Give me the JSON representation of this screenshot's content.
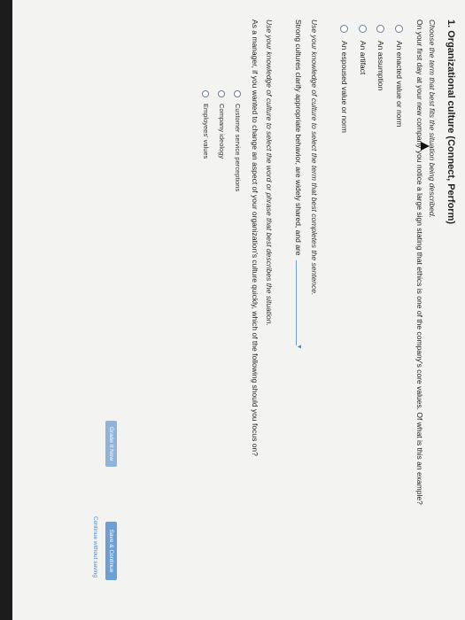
{
  "question": {
    "number_title": "1. Organizational culture (Connect, Perform)"
  },
  "part1": {
    "instruction": "Choose the term that best fits the situation being described.",
    "prompt": "On your first day at your new company you notice a large sign stating that ethics is one of the company's core values. Of what is this an example?",
    "options": [
      "An enacted value or norm",
      "An assumption",
      "An artifact",
      "An espoused value or norm"
    ]
  },
  "part2": {
    "instruction": "Use your knowledge of culture to select the term that best completes the sentence.",
    "sentence": "Strong cultures clarify appropriate behavior, are widely shared, and are",
    "caret_icon": "chevron-down-icon"
  },
  "part3": {
    "instruction": "Use your knowledge of culture to select the word or phrase that best describes the situation.",
    "prompt": "As a manager, if you wanted to change an aspect of your organization's culture quickly, which of the following should you focus on?",
    "options": [
      "Customer service perceptions",
      "Company ideology",
      "Employees' values"
    ]
  },
  "footer": {
    "grade_label": "Grade It Now",
    "save_label": "Save & Continue",
    "continue_link": "Continue without saving"
  },
  "colors": {
    "accent": "#4f86c6",
    "grade_button": "#8fb3d9",
    "save_button": "#6c9fd3"
  }
}
